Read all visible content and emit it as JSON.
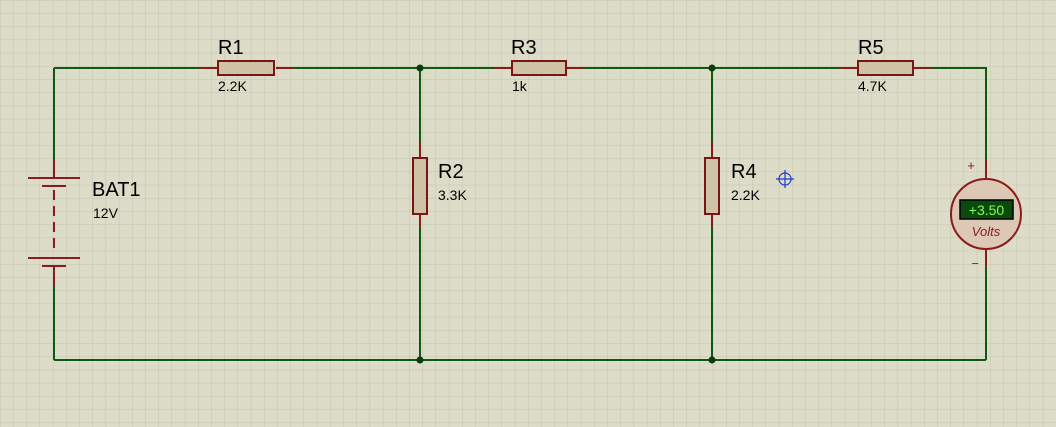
{
  "components": {
    "battery": {
      "ref": "BAT1",
      "value": "12V"
    },
    "r1": {
      "ref": "R1",
      "value": "2.2K"
    },
    "r2": {
      "ref": "R2",
      "value": "3.3K"
    },
    "r3": {
      "ref": "R3",
      "value": "1k"
    },
    "r4": {
      "ref": "R4",
      "value": "2.2K"
    },
    "r5": {
      "ref": "R5",
      "value": "4.7K"
    }
  },
  "voltmeter": {
    "reading": "+3.50",
    "unit": "Volts",
    "plus": "+",
    "minus": "−"
  },
  "colors": {
    "background": "#dcdcc8",
    "grid": "#c8c8b4",
    "wire": "#0e5a0e",
    "component": "#8b1a1a",
    "display_bg": "#0a4a0a",
    "display_text": "#7fff5a"
  },
  "icons": {
    "cursor": "crosshair-target-icon"
  }
}
